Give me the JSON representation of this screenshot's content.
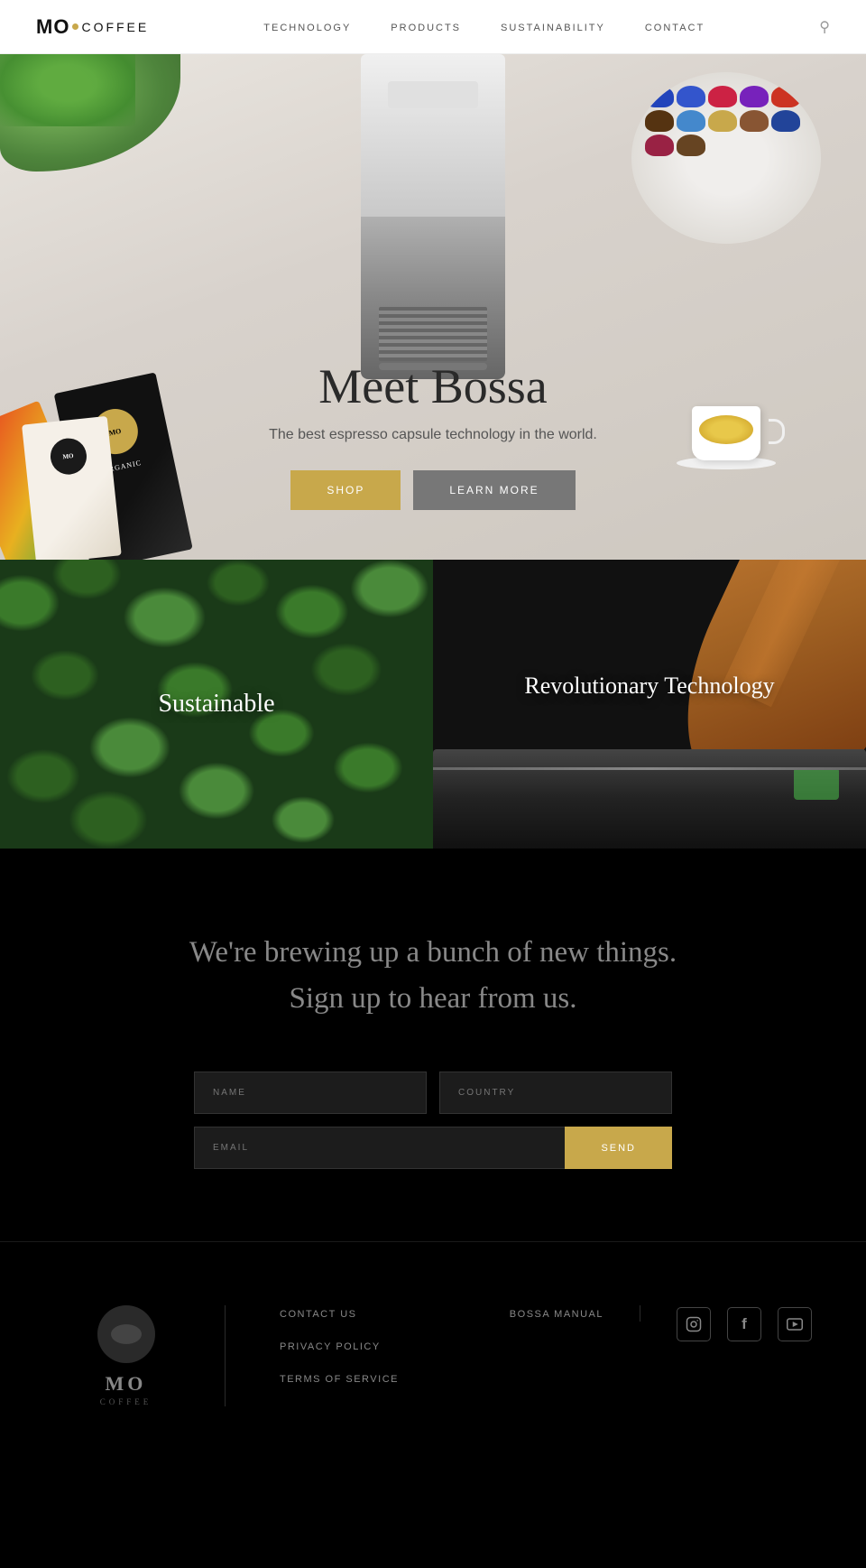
{
  "navbar": {
    "logo": "MO",
    "logo_dot": "·",
    "logo_suffix": "COFFEE",
    "links": [
      {
        "label": "TECHNOLOGY",
        "id": "technology"
      },
      {
        "label": "PRODUCTS",
        "id": "products"
      },
      {
        "label": "SUSTAINABILITY",
        "id": "sustainability"
      },
      {
        "label": "CONTACT",
        "id": "contact"
      }
    ],
    "search_label": "Search"
  },
  "hero": {
    "title": "Meet Bossa",
    "subtitle": "The best espresso capsule technology in the world.",
    "btn_shop": "SHOP",
    "btn_learn": "LEARN MORE"
  },
  "pods": [
    {
      "color": "#2244aa"
    },
    {
      "color": "#3355cc"
    },
    {
      "color": "#cc2244"
    },
    {
      "color": "#884422"
    },
    {
      "color": "#553311"
    },
    {
      "color": "#7722aa"
    },
    {
      "color": "#4488cc"
    },
    {
      "color": "#224499"
    },
    {
      "color": "#aa3322"
    },
    {
      "color": "#995533"
    },
    {
      "color": "#332211"
    },
    {
      "color": "#c8a84b"
    }
  ],
  "cards": [
    {
      "label": "Sustainable",
      "id": "sustainable"
    },
    {
      "label": "Revolutionary Technology",
      "id": "technology"
    }
  ],
  "signup": {
    "headline_line1": "We're brewing up a bunch of new things.",
    "headline_line2": "Sign up to hear from us.",
    "name_placeholder": "NAME",
    "country_placeholder": "COUNTRY",
    "email_placeholder": "EMAIL",
    "send_label": "SEND"
  },
  "footer": {
    "logo_text": "MO",
    "logo_sub": "COFFEE",
    "links": [
      {
        "label": "CONTACT US",
        "href": "#"
      },
      {
        "label": "PRIVACY POLICY",
        "href": "#"
      },
      {
        "label": "TERMS OF SERVICE",
        "href": "#"
      }
    ],
    "manual_link": "BOSSA MANUAL",
    "social": [
      {
        "name": "instagram",
        "icon": "📷"
      },
      {
        "name": "facebook",
        "icon": "f"
      },
      {
        "name": "youtube",
        "icon": "▶"
      }
    ]
  }
}
